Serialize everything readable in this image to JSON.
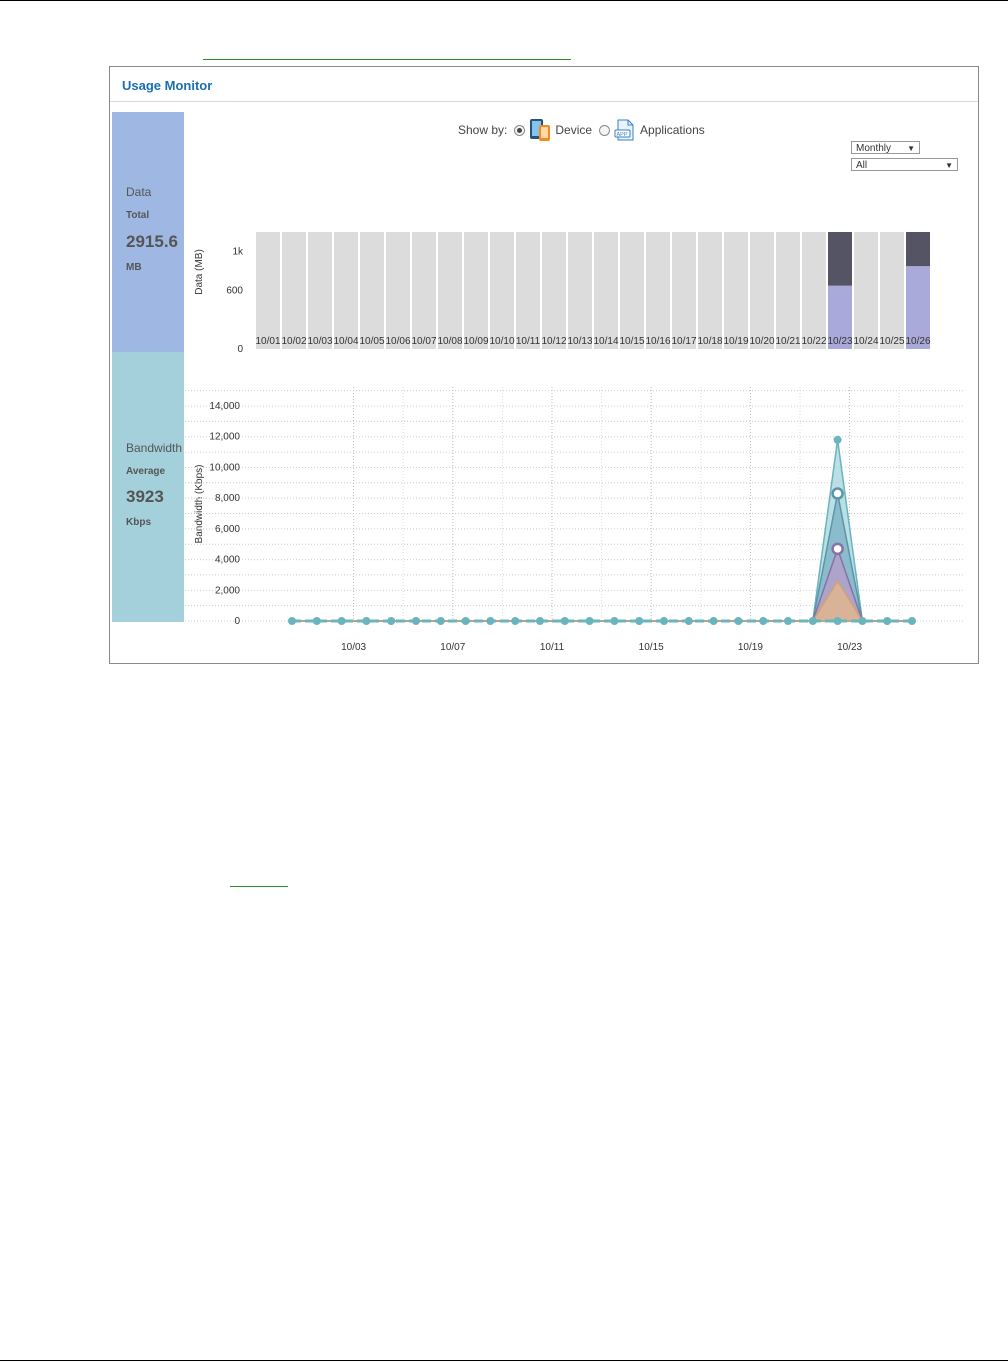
{
  "panel": {
    "title": "Usage Monitor"
  },
  "data_summary": {
    "label": "Data",
    "sub_label": "Total",
    "value": "2915.6",
    "unit": "MB"
  },
  "bandwidth_summary": {
    "label": "Bandwidth",
    "sub_label": "Average",
    "value": "3923",
    "unit": "Kbps"
  },
  "show_by": {
    "label": "Show by:",
    "options": [
      {
        "label": "Device",
        "selected": true,
        "icon": "device-icon"
      },
      {
        "label": "Applications",
        "selected": false,
        "icon": "app-icon"
      }
    ]
  },
  "period_select": {
    "value": "Monthly"
  },
  "filter_select": {
    "value": "All"
  },
  "colors": {
    "bar_bg": "#dcdcdc",
    "bar_dark": "#545464",
    "bar_light": "#a9a9da",
    "line": "#6ab4be",
    "side_data": "#9fb8e3",
    "side_bw": "#a3d0db",
    "title": "#1a6fb3"
  },
  "chart_data": [
    {
      "type": "bar",
      "ylabel": "Data (MB)",
      "ylim": [
        0,
        1200
      ],
      "y_ticks": [
        "0",
        "600",
        "1k"
      ],
      "categories": [
        "10/01",
        "10/02",
        "10/03",
        "10/04",
        "10/05",
        "10/06",
        "10/07",
        "10/08",
        "10/09",
        "10/10",
        "10/11",
        "10/12",
        "10/13",
        "10/14",
        "10/15",
        "10/16",
        "10/17",
        "10/18",
        "10/19",
        "10/20",
        "10/21",
        "10/22",
        "10/23",
        "10/24",
        "10/25",
        "10/26"
      ],
      "series": [
        {
          "values": [
            0,
            0,
            0,
            0,
            0,
            0,
            0,
            0,
            0,
            0,
            0,
            0,
            0,
            0,
            0,
            0,
            0,
            0,
            0,
            0,
            0,
            0,
            650,
            0,
            0,
            850
          ]
        },
        {
          "values": [
            0,
            0,
            0,
            0,
            0,
            0,
            0,
            0,
            0,
            0,
            0,
            0,
            0,
            0,
            0,
            0,
            0,
            0,
            0,
            0,
            0,
            0,
            800,
            0,
            0,
            550
          ]
        }
      ]
    },
    {
      "type": "line",
      "ylabel": "Bandwidth (Kbps)",
      "ylim": [
        0,
        14000
      ],
      "y_ticks": [
        "0",
        "2,000",
        "4,000",
        "6,000",
        "8,000",
        "10,000",
        "12,000",
        "14,000"
      ],
      "x_ticks": [
        "10/03",
        "10/07",
        "10/11",
        "10/15",
        "10/19",
        "10/23"
      ],
      "days": [
        1,
        2,
        3,
        4,
        5,
        6,
        7,
        8,
        9,
        10,
        11,
        12,
        13,
        14,
        15,
        16,
        17,
        18,
        19,
        20,
        21,
        22,
        23,
        24,
        25,
        26
      ],
      "series": [
        {
          "values": [
            0,
            0,
            0,
            0,
            0,
            0,
            0,
            0,
            0,
            0,
            0,
            0,
            0,
            0,
            0,
            0,
            0,
            0,
            0,
            0,
            0,
            0,
            11800,
            0,
            0,
            0
          ]
        },
        {
          "values": [
            0,
            0,
            0,
            0,
            0,
            0,
            0,
            0,
            0,
            0,
            0,
            0,
            0,
            0,
            0,
            0,
            0,
            0,
            0,
            0,
            0,
            0,
            8300,
            0,
            0,
            0
          ]
        },
        {
          "values": [
            0,
            0,
            0,
            0,
            0,
            0,
            0,
            0,
            0,
            0,
            0,
            0,
            0,
            0,
            0,
            0,
            0,
            0,
            0,
            0,
            0,
            0,
            4700,
            0,
            0,
            0
          ]
        },
        {
          "values": [
            0,
            0,
            0,
            0,
            0,
            0,
            0,
            0,
            0,
            0,
            0,
            0,
            0,
            0,
            0,
            0,
            0,
            0,
            0,
            0,
            0,
            0,
            2600,
            0,
            0,
            0
          ]
        }
      ]
    }
  ]
}
